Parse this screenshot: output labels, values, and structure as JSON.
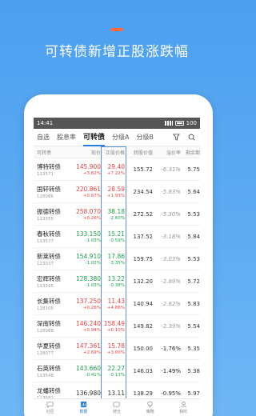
{
  "promo": {
    "title": "可转债新增正股涨跌幅",
    "accent_color": "#ff6a3d"
  },
  "statusbar": {
    "time": "14:41",
    "battery": "100"
  },
  "tabs": [
    {
      "label": "自选",
      "active": false
    },
    {
      "label": "股息率",
      "active": false
    },
    {
      "label": "可转债",
      "active": true
    },
    {
      "label": "分级A",
      "active": false
    },
    {
      "label": "分级B",
      "active": false
    }
  ],
  "tab_icons": [
    "filter-icon",
    "search-icon"
  ],
  "columns": [
    "可转债",
    "现价",
    "正股价格",
    "转股价值",
    "溢价率",
    "剩余期"
  ],
  "rows": [
    {
      "name": "博特转债",
      "code": "113571",
      "price": "145.900",
      "price_pct": "+3.82%",
      "stock": "29.40",
      "stock_pct": "+7.22%",
      "conv": "155.72",
      "prem": "-6.31%",
      "rem": "5.75"
    },
    {
      "name": "国轩转债",
      "code": "128086",
      "price": "220.861",
      "price_pct": "+0.67%",
      "stock": "28.59",
      "stock_pct": "+1.93%",
      "conv": "234.54",
      "prem": "-5.83%",
      "rem": "5.64"
    },
    {
      "name": "振德转债",
      "code": "113555",
      "price": "258.070",
      "price_pct": "+0.26%",
      "stock": "38.18",
      "stock_pct": "-2.60%",
      "conv": "272.52",
      "prem": "-5.30%",
      "rem": "5.53"
    },
    {
      "name": "春秋转债",
      "code": "113577",
      "price": "133.150",
      "price_pct": "-1.03%",
      "stock": "15.21",
      "stock_pct": "-0.59%",
      "conv": "137.52",
      "prem": "-3.18%",
      "rem": "5.84"
    },
    {
      "name": "新莱转债",
      "code": "123037",
      "price": "154.910",
      "price_pct": "-1.03%",
      "stock": "17.86",
      "stock_pct": "-3.35%",
      "conv": "159.75",
      "prem": "-3.03%",
      "rem": "5.53"
    },
    {
      "name": "宏辉转债",
      "code": "113565",
      "price": "128.380",
      "price_pct": "-1.03%",
      "stock": "13.22",
      "stock_pct": "-0.38%",
      "conv": "132.20",
      "prem": "-2.89%",
      "rem": "5.72"
    },
    {
      "name": "长集转债",
      "code": "128105",
      "price": "137.250",
      "price_pct": "+0.26%",
      "stock": "11.43",
      "stock_pct": "+4.86%",
      "conv": "140.94",
      "prem": "-2.62%",
      "rem": "5.83"
    },
    {
      "name": "深南转债",
      "code": "128088",
      "price": "146.240",
      "price_pct": "+0.94%",
      "stock": "158.49",
      "stock_pct": "+0.10%",
      "conv": "149.82",
      "prem": "-2.39%",
      "rem": "5.54"
    },
    {
      "name": "华夏转债",
      "code": "128077",
      "price": "147.361",
      "price_pct": "+2.69%",
      "stock": "15.78",
      "stock_pct": "+3.00%",
      "conv": "150.00",
      "prem": "-1.76%",
      "rem": "5.35"
    },
    {
      "name": "石英转债",
      "code": "113548",
      "price": "143.660",
      "price_pct": "-0.41%",
      "stock": "22.27",
      "stock_pct": "-0.13%",
      "conv": "146.03",
      "prem": "-1.49%",
      "rem": "5.38"
    },
    {
      "name": "龙蟠转债",
      "code": "113581",
      "price": "136.980",
      "price_pct": "",
      "stock": "13.11",
      "stock_pct": "",
      "conv": "138.29",
      "prem": "-0.95%",
      "rem": "5.97"
    }
  ],
  "bottom_nav": [
    {
      "label": "社区",
      "icon": "chat-icon",
      "active": false
    },
    {
      "label": "数据",
      "icon": "data-icon",
      "active": true
    },
    {
      "label": "持仓",
      "icon": "wallet-icon",
      "active": false
    },
    {
      "label": "策略",
      "icon": "bulb-icon",
      "active": false
    },
    {
      "label": "我的",
      "icon": "user-icon",
      "active": false
    }
  ]
}
